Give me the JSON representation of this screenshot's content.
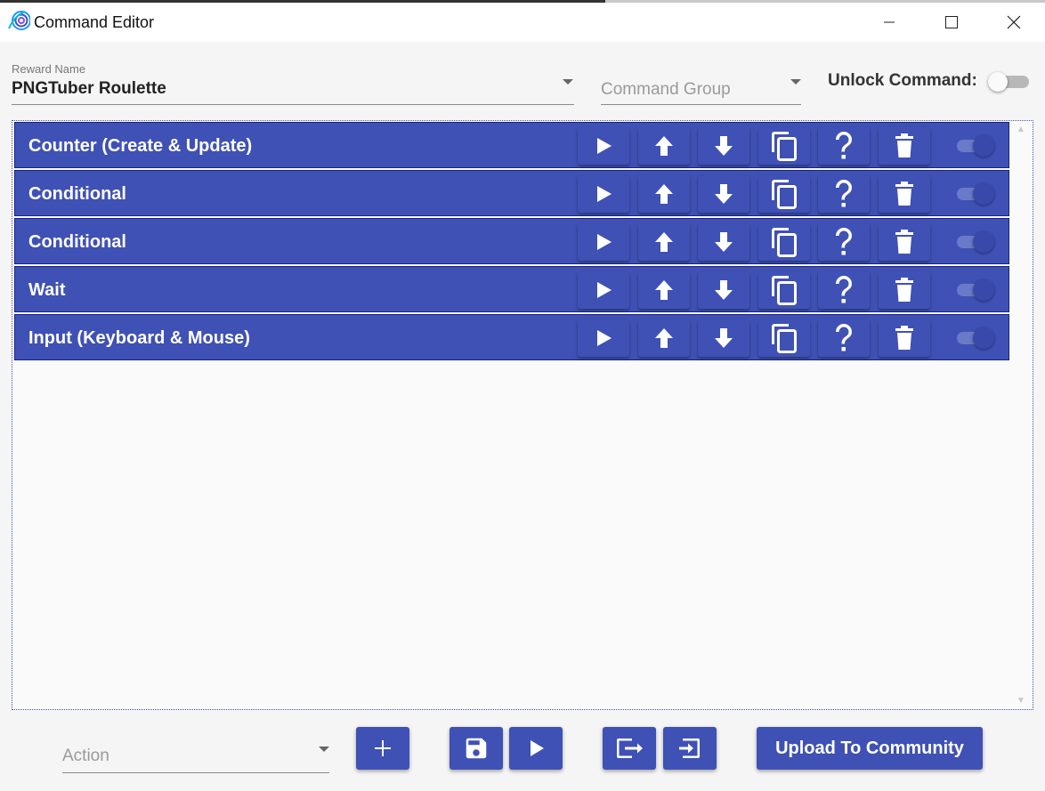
{
  "window": {
    "title": "Command Editor",
    "logo_icon": "app-logo-icon",
    "controls": [
      "minimize-icon",
      "maximize-icon",
      "close-icon"
    ]
  },
  "form": {
    "reward_name_label": "Reward Name",
    "reward_name_value": "PNGTuber Roulette",
    "command_group_placeholder": "Command Group",
    "unlock_label": "Unlock Command:",
    "unlock_enabled": false
  },
  "actions": [
    {
      "label": "Counter (Create & Update)",
      "enabled": true
    },
    {
      "label": "Conditional",
      "enabled": true
    },
    {
      "label": "Conditional",
      "enabled": true
    },
    {
      "label": "Wait",
      "enabled": true
    },
    {
      "label": "Input (Keyboard & Mouse)",
      "enabled": true
    }
  ],
  "row_buttons": [
    "play-icon",
    "arrow-up-icon",
    "arrow-down-icon",
    "copy-icon",
    "help-icon",
    "delete-icon"
  ],
  "footer": {
    "action_placeholder": "Action",
    "upload_label": "Upload To Community",
    "buttons": [
      "add-icon",
      "save-icon",
      "play-icon",
      "export-icon",
      "import-icon"
    ]
  },
  "colors": {
    "primary": "#3f51b5",
    "primary_dark": "#1a237e",
    "toggle_track_on": "#6a7ac8",
    "toggle_knob_on": "#3949ab"
  }
}
